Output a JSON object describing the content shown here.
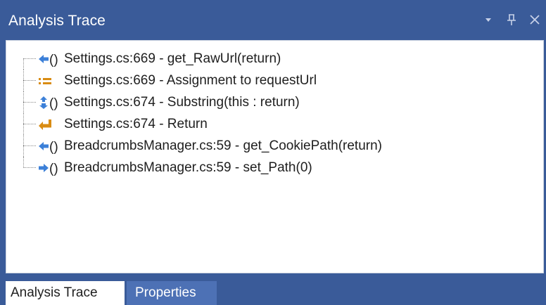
{
  "panel": {
    "title": "Analysis Trace",
    "controls": [
      "chevron-down-icon",
      "pin-icon",
      "close-icon"
    ]
  },
  "trace": [
    {
      "icon": "method-return-arrow-icon",
      "glyph": "()",
      "text": "Settings.cs:669 - get_RawUrl(return)"
    },
    {
      "icon": "assignment-icon",
      "glyph": "",
      "text": "Settings.cs:669 - Assignment to requestUrl"
    },
    {
      "icon": "method-this-return-icon",
      "glyph": "()",
      "text": "Settings.cs:674 - Substring(this : return)"
    },
    {
      "icon": "return-arrow-icon",
      "glyph": "",
      "text": "Settings.cs:674 - Return"
    },
    {
      "icon": "method-return-arrow-icon",
      "glyph": "()",
      "text": "BreadcrumbsManager.cs:59 - get_CookiePath(return)"
    },
    {
      "icon": "method-param-arrow-icon",
      "glyph": "()",
      "text": "BreadcrumbsManager.cs:59 - set_Path(0)"
    }
  ],
  "tabs": [
    {
      "label": "Analysis Trace",
      "active": true
    },
    {
      "label": "Properties",
      "active": false
    }
  ],
  "colors": {
    "chrome": "#3a5b99",
    "inactive_tab": "#4d71b5",
    "icon_blue": "#3c80d8",
    "icon_orange": "#d98c13"
  }
}
